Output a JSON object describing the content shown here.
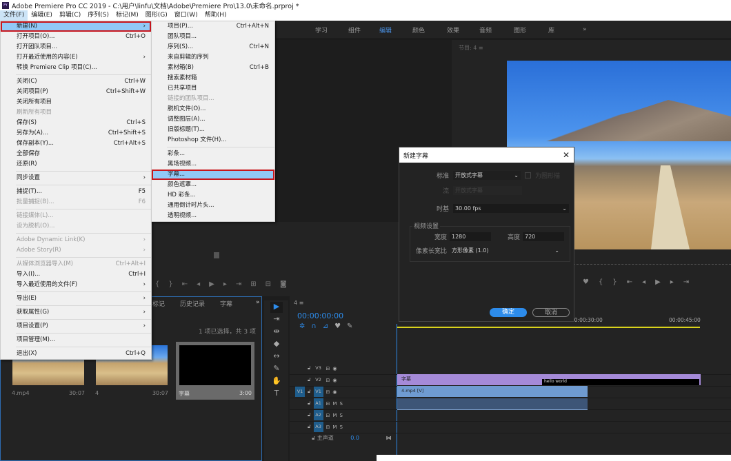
{
  "window": {
    "title": "Adobe Premiere Pro CC 2019 - C:\\用户\\linfu\\文档\\Adobe\\Premiere Pro\\13.0\\未命名.prproj *",
    "app_icon": "Pr"
  },
  "menubar": [
    "文件(F)",
    "编辑(E)",
    "剪辑(C)",
    "序列(S)",
    "标记(M)",
    "图形(G)",
    "窗口(W)",
    "帮助(H)"
  ],
  "file_menu": [
    {
      "label": "新建(N)",
      "arrow": true,
      "hl": true
    },
    {
      "label": "打开项目(O)...",
      "shortcut": "Ctrl+O"
    },
    {
      "label": "打开团队项目..."
    },
    {
      "label": "打开最近使用的内容(E)",
      "arrow": true
    },
    {
      "label": "转换 Premiere Clip 项目(C)..."
    },
    {
      "sep": true
    },
    {
      "label": "关闭(C)",
      "shortcut": "Ctrl+W"
    },
    {
      "label": "关闭项目(P)",
      "shortcut": "Ctrl+Shift+W"
    },
    {
      "label": "关闭所有项目"
    },
    {
      "label": "刷新所有项目",
      "disabled": true
    },
    {
      "label": "保存(S)",
      "shortcut": "Ctrl+S"
    },
    {
      "label": "另存为(A)...",
      "shortcut": "Ctrl+Shift+S"
    },
    {
      "label": "保存副本(Y)...",
      "shortcut": "Ctrl+Alt+S"
    },
    {
      "label": "全部保存"
    },
    {
      "label": "还原(R)"
    },
    {
      "sep": true
    },
    {
      "label": "同步设置",
      "arrow": true
    },
    {
      "sep": true
    },
    {
      "label": "捕捉(T)...",
      "shortcut": "F5"
    },
    {
      "label": "批量捕捉(B)...",
      "shortcut": "F6",
      "disabled": true
    },
    {
      "sep": true
    },
    {
      "label": "链接媒体(L)...",
      "disabled": true
    },
    {
      "label": "设为脱机(O)...",
      "disabled": true
    },
    {
      "sep": true
    },
    {
      "label": "Adobe Dynamic Link(K)",
      "arrow": true,
      "disabled": true
    },
    {
      "label": "Adobe Story(R)",
      "arrow": true,
      "disabled": true
    },
    {
      "sep": true
    },
    {
      "label": "从媒体浏览器导入(M)",
      "shortcut": "Ctrl+Alt+I",
      "disabled": true
    },
    {
      "label": "导入(I)...",
      "shortcut": "Ctrl+I"
    },
    {
      "label": "导入最近使用的文件(F)",
      "arrow": true
    },
    {
      "sep": true
    },
    {
      "label": "导出(E)",
      "arrow": true
    },
    {
      "sep": true
    },
    {
      "label": "获取属性(G)",
      "arrow": true
    },
    {
      "sep": true
    },
    {
      "label": "项目设置(P)",
      "arrow": true
    },
    {
      "sep": true
    },
    {
      "label": "项目管理(M)..."
    },
    {
      "sep": true
    },
    {
      "label": "退出(X)",
      "shortcut": "Ctrl+Q"
    }
  ],
  "new_submenu": [
    {
      "label": "项目(P)...",
      "shortcut": "Ctrl+Alt+N"
    },
    {
      "label": "团队项目..."
    },
    {
      "label": "序列(S)...",
      "shortcut": "Ctrl+N"
    },
    {
      "label": "来自剪辑的序列"
    },
    {
      "label": "素材箱(B)",
      "shortcut": "Ctrl+B"
    },
    {
      "label": "搜索素材箱"
    },
    {
      "label": "已共享项目"
    },
    {
      "label": "链接的团队项目...",
      "disabled": true
    },
    {
      "label": "脱机文件(O)..."
    },
    {
      "label": "调整图层(A)..."
    },
    {
      "label": "旧版标题(T)..."
    },
    {
      "label": "Photoshop 文件(H)..."
    },
    {
      "sep": true
    },
    {
      "label": "彩条..."
    },
    {
      "label": "黑场视频..."
    },
    {
      "label": "字幕...",
      "hl": true
    },
    {
      "label": "颜色遮罩..."
    },
    {
      "label": "HD 彩条..."
    },
    {
      "label": "通用倒计时片头..."
    },
    {
      "label": "透明视频..."
    }
  ],
  "workspace_tabs": [
    {
      "label": "学习"
    },
    {
      "label": "组件"
    },
    {
      "label": "编辑",
      "selected": true
    },
    {
      "label": "颜色"
    },
    {
      "label": "效果"
    },
    {
      "label": "音频"
    },
    {
      "label": "图形"
    },
    {
      "label": "库"
    }
  ],
  "monitor": {
    "title": "节目: 4 ≡"
  },
  "dialog": {
    "title": "新建字幕",
    "standard_label": "标准",
    "standard_value": "开放式字幕",
    "checkbox_label": "为图形描",
    "stream_label": "流",
    "stream_value": "开放式字幕",
    "timebase_label": "时基",
    "timebase_value": "30.00 fps",
    "video_settings_label": "视频设置",
    "width_label": "宽度",
    "width_value": "1280",
    "height_label": "高度",
    "height_value": "720",
    "par_label": "像素长宽比",
    "par_value": "方形像素 (1.0)",
    "ok": "确定",
    "cancel": "取消"
  },
  "project": {
    "tabs": [
      "标记",
      "历史记录",
      "字幕"
    ],
    "selection_info": "1 项已选择，共 3 项",
    "items": [
      {
        "name": "4.mp4",
        "duration": "30:07"
      },
      {
        "name": "4",
        "duration": "30:07"
      },
      {
        "name": "字幕",
        "duration": "3:00"
      }
    ]
  },
  "timeline": {
    "seq_tab": "4 ≡",
    "timecode": "00:00:00:00",
    "ruler": [
      "00:00:30:00",
      "00:00:45:00"
    ],
    "tracks": [
      {
        "name": "V3",
        "type": "v"
      },
      {
        "name": "V2",
        "type": "v"
      },
      {
        "name": "V1",
        "type": "v",
        "src": "V1"
      },
      {
        "name": "A1",
        "type": "a"
      },
      {
        "name": "A2",
        "type": "a"
      },
      {
        "name": "A3",
        "type": "a"
      }
    ],
    "master_label": "主声道",
    "master_value": "0.0",
    "clips": {
      "caption": "字幕",
      "caption_text": "hello world",
      "video": "4.mp4 [V]"
    }
  },
  "colors": {
    "accent": "#2d8ceb",
    "highlight": "#91c9f7",
    "outline": "#c8161d",
    "caption_clip": "#a58ad8",
    "video_clip": "#6f9bd1"
  }
}
